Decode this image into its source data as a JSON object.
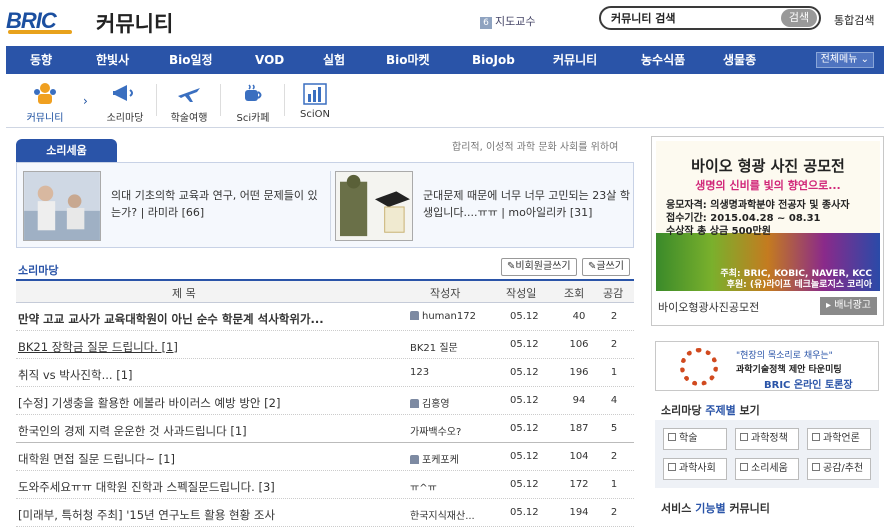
{
  "header": {
    "logo_text": "BRIC",
    "site_title": "커뮤니티",
    "advisor_num": "6",
    "advisor_label": "지도교수",
    "search_value": "커뮤니티 검색",
    "search_button": "검색",
    "total_search": "통합검색"
  },
  "nav": {
    "items": [
      "동향",
      "한빛사",
      "Bio일정",
      "VOD",
      "실험",
      "Bio마켓",
      "BioJob",
      "커뮤니티",
      "농수식품",
      "생물종"
    ],
    "all_menu": "전체메뉴 ⌄"
  },
  "subnav": [
    "커뮤니티",
    "소리마당",
    "학술여행",
    "Sci카페",
    "SciON"
  ],
  "sori": {
    "tab": "소리세움",
    "tagline": "합리적, 이성적 과학 문화 사회를 위하여",
    "cards": [
      {
        "text": "의대 기초의학 교육과 연구, 어떤 문제들이 있는가? | 라미라",
        "count": "[66]"
      },
      {
        "text": "군대문제 때문에 너무 너무 고민되는 23살 학생입니다....ㅠㅠ | mo아일리카",
        "count": "[31]"
      }
    ]
  },
  "board": {
    "title": "소리마당",
    "btn_anon": "비회원글쓰기",
    "btn_write": "글쓰기",
    "headers": {
      "title": "제            목",
      "author": "작성자",
      "date": "작성일",
      "views": "조회",
      "like": "공감"
    },
    "rows": [
      {
        "title": "만약 고교 교사가 교육대학원이 아닌 순수 학문계 석사학위가...",
        "author": "human172",
        "date": "05.12",
        "views": "40",
        "like": "2"
      },
      {
        "title": "BK21 장학금 질문 드립니다. [1]",
        "author": "BK21 질문",
        "date": "05.12",
        "views": "106",
        "like": "2"
      },
      {
        "title": "취직 vs 박사진학... [1]",
        "author": "123",
        "date": "05.12",
        "views": "196",
        "like": "1"
      },
      {
        "title": "[수정] 기생충을 활용한 에볼라 바이러스 예방 방안 [2]",
        "author": "김홍영",
        "date": "05.12",
        "views": "94",
        "like": "4"
      },
      {
        "title": "한국인의 경제 지력 운운한 것 사과드립니다 [1]",
        "author": "가짜백수오?",
        "date": "05.12",
        "views": "187",
        "like": "5"
      },
      {
        "title": "대학원 면접 질문 드립니다~ [1]",
        "author": "포케포케",
        "date": "05.12",
        "views": "104",
        "like": "2"
      },
      {
        "title": "도와주세요ㅠㅠ 대학원 진학과 스펙질문드립니다. [3]",
        "author": "ㅠ^ㅠ",
        "date": "05.12",
        "views": "172",
        "like": "1"
      },
      {
        "title": "[미래부, 특허청 주최] '15년 연구노트 활용 현황 조사",
        "author": "한국지식재산...",
        "date": "05.12",
        "views": "194",
        "like": "2"
      }
    ]
  },
  "right": {
    "contest_h1": "바이오 형광 사진 공모전",
    "contest_h2": "생명의 신비를 빛의 향연으로...",
    "contest_l1": "응모자격: 의생명과학분야 전공자 및 종사자",
    "contest_l2": "접수기간: 2015.04.28 ~ 08.31",
    "contest_l3": "수상작 총 상금 500만원",
    "contest_f1": "주최: BRIC, KOBIC, NAVER, KCC",
    "contest_f2": "후원: (유)라이프 테크놀로지스 코리아",
    "contest_caption": "바이오형광사진공모전",
    "ad_button": "▸ 배너광고",
    "forum_l1": "\"현장의 목소리로 채우는\"",
    "forum_l2": "과학기술정책 제안 타운미팅",
    "forum_l3": "BRIC 온라인 토론장",
    "topic_title_a": "소리마당",
    "topic_title_hl": "주제별",
    "topic_title_b": "보기",
    "topics": [
      "학술",
      "과학정책",
      "과학언론",
      "과학사회",
      "소리세움",
      "공감/추천"
    ],
    "svc_title_a": "서비스",
    "svc_title_hl": "기능별",
    "svc_title_b": "커뮤니티"
  }
}
